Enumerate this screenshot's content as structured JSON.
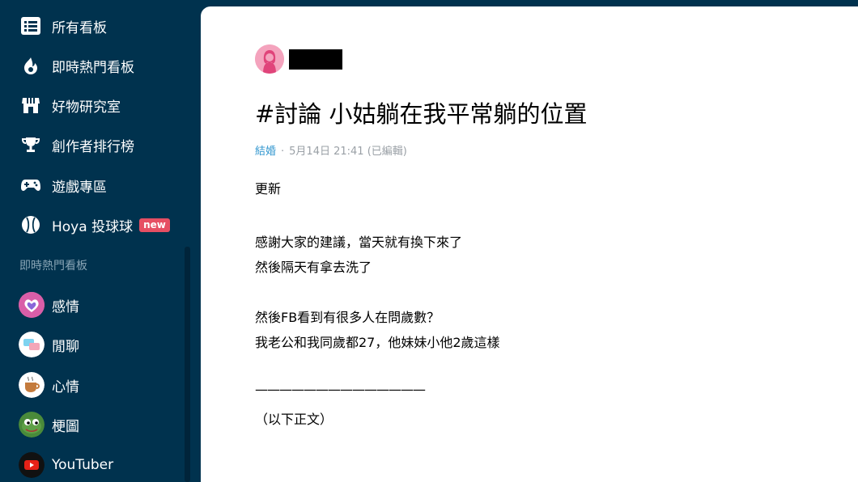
{
  "sidebar": {
    "nav": [
      {
        "label": "所有看板",
        "icon": "list-icon"
      },
      {
        "label": "即時熱門看板",
        "icon": "fire-icon"
      },
      {
        "label": "好物研究室",
        "icon": "store-icon"
      },
      {
        "label": "創作者排行榜",
        "icon": "trophy-icon"
      },
      {
        "label": "遊戲專區",
        "icon": "gamepad-icon"
      },
      {
        "label": "Hoya 投球球",
        "icon": "baseball-icon",
        "badge": "new"
      }
    ],
    "section_title": "即時熱門看板",
    "forums": [
      {
        "label": "感情",
        "icon": "heart-icon"
      },
      {
        "label": "閒聊",
        "icon": "chat-icon"
      },
      {
        "label": "心情",
        "icon": "coffee-icon"
      },
      {
        "label": "梗圖",
        "icon": "frog-icon"
      },
      {
        "label": "YouTuber",
        "icon": "youtube-icon"
      }
    ]
  },
  "post": {
    "title": "#討論 小姑躺在我平常躺的位置",
    "forum": "結婚",
    "date": "5月14日 21:41",
    "edited": "(已編輯)",
    "lines": [
      "更新",
      "",
      "感謝大家的建議，當天就有換下來了",
      "然後隔天有拿去洗了",
      "",
      "然後FB看到有很多人在問歲數？",
      "我老公和我同歲都27，他妹妹小他2歲這樣",
      "",
      "——————————————",
      "（以下正文）"
    ]
  },
  "colors": {
    "sidebar_bg": "#00324e",
    "badge": "#e64f63",
    "forum_link": "#3397cf",
    "meta_text": "#9aa0a6"
  }
}
